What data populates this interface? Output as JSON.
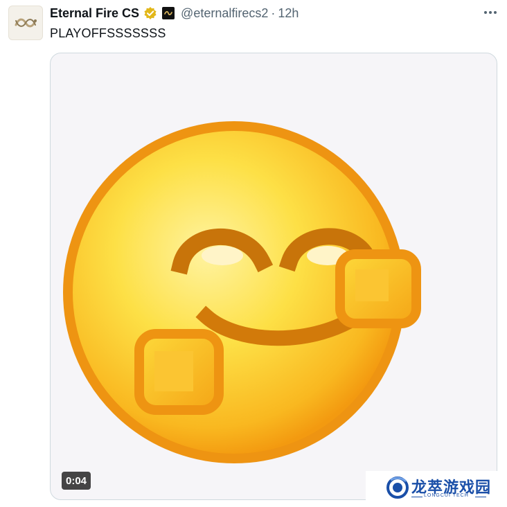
{
  "tweet": {
    "display_name": "Eternal Fire CS",
    "handle": "@eternalfirecs2",
    "separator": "·",
    "time": "12h",
    "text": "PLAYOFFSSSSSSS",
    "avatar_icon": "dragon-logo-icon",
    "verified_icon": "gold-verified-badge-icon",
    "affiliate_icon": "affiliate-badge-icon",
    "more_icon": "more-options-icon"
  },
  "media": {
    "type": "video",
    "duration": "0:04",
    "content_icon": "smug-smiley-face-emoji"
  },
  "watermark": {
    "text": "龙萃游戏园",
    "subtext": "LONGCUI TECH"
  },
  "colors": {
    "name": "#0f1419",
    "secondary": "#536471",
    "verified_gold": "#e2b719",
    "emoji_yellow": "#fbd12f",
    "emoji_orange": "#f39a10",
    "watermark_blue": "#1a4fa8"
  }
}
